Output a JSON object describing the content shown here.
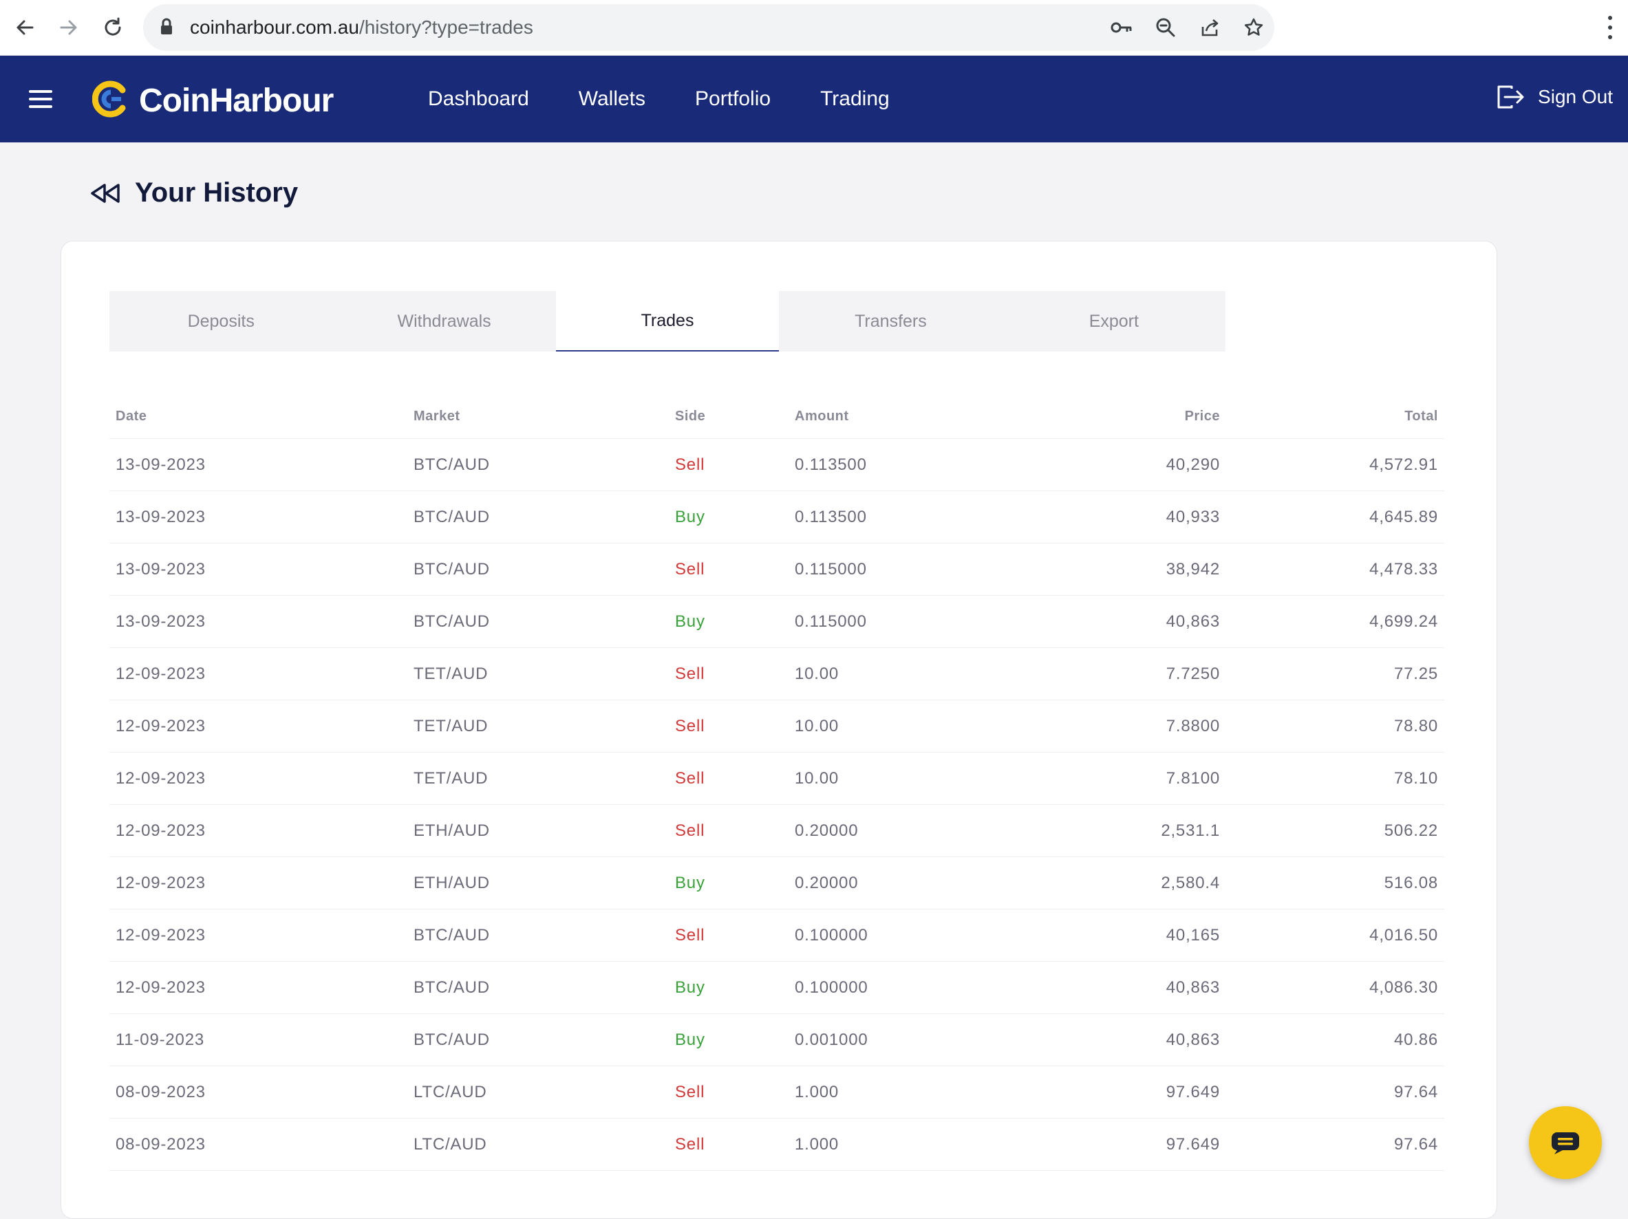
{
  "browser": {
    "url_host": "coinharbour.com.au",
    "url_path": "/history?type=trades"
  },
  "app": {
    "brand": "CoinHarbour",
    "nav": [
      "Dashboard",
      "Wallets",
      "Portfolio",
      "Trading"
    ],
    "sign_out": "Sign Out"
  },
  "page": {
    "title": "Your History"
  },
  "tabs": [
    {
      "label": "Deposits",
      "active": false
    },
    {
      "label": "Withdrawals",
      "active": false
    },
    {
      "label": "Trades",
      "active": true
    },
    {
      "label": "Transfers",
      "active": false
    },
    {
      "label": "Export",
      "active": false
    }
  ],
  "table": {
    "headers": {
      "date": "Date",
      "market": "Market",
      "side": "Side",
      "amount": "Amount",
      "price": "Price",
      "total": "Total"
    },
    "rows": [
      {
        "date": "13-09-2023",
        "market": "BTC/AUD",
        "side": "Sell",
        "amount": "0.113500",
        "price": "40,290",
        "total": "4,572.91"
      },
      {
        "date": "13-09-2023",
        "market": "BTC/AUD",
        "side": "Buy",
        "amount": "0.113500",
        "price": "40,933",
        "total": "4,645.89"
      },
      {
        "date": "13-09-2023",
        "market": "BTC/AUD",
        "side": "Sell",
        "amount": "0.115000",
        "price": "38,942",
        "total": "4,478.33"
      },
      {
        "date": "13-09-2023",
        "market": "BTC/AUD",
        "side": "Buy",
        "amount": "0.115000",
        "price": "40,863",
        "total": "4,699.24"
      },
      {
        "date": "12-09-2023",
        "market": "TET/AUD",
        "side": "Sell",
        "amount": "10.00",
        "price": "7.7250",
        "total": "77.25"
      },
      {
        "date": "12-09-2023",
        "market": "TET/AUD",
        "side": "Sell",
        "amount": "10.00",
        "price": "7.8800",
        "total": "78.80"
      },
      {
        "date": "12-09-2023",
        "market": "TET/AUD",
        "side": "Sell",
        "amount": "10.00",
        "price": "7.8100",
        "total": "78.10"
      },
      {
        "date": "12-09-2023",
        "market": "ETH/AUD",
        "side": "Sell",
        "amount": "0.20000",
        "price": "2,531.1",
        "total": "506.22"
      },
      {
        "date": "12-09-2023",
        "market": "ETH/AUD",
        "side": "Buy",
        "amount": "0.20000",
        "price": "2,580.4",
        "total": "516.08"
      },
      {
        "date": "12-09-2023",
        "market": "BTC/AUD",
        "side": "Sell",
        "amount": "0.100000",
        "price": "40,165",
        "total": "4,016.50"
      },
      {
        "date": "12-09-2023",
        "market": "BTC/AUD",
        "side": "Buy",
        "amount": "0.100000",
        "price": "40,863",
        "total": "4,086.30"
      },
      {
        "date": "11-09-2023",
        "market": "BTC/AUD",
        "side": "Buy",
        "amount": "0.001000",
        "price": "40,863",
        "total": "40.86"
      },
      {
        "date": "08-09-2023",
        "market": "LTC/AUD",
        "side": "Sell",
        "amount": "1.000",
        "price": "97.649",
        "total": "97.64"
      },
      {
        "date": "08-09-2023",
        "market": "LTC/AUD",
        "side": "Sell",
        "amount": "1.000",
        "price": "97.649",
        "total": "97.64"
      }
    ]
  },
  "colors": {
    "navbar": "#182a78",
    "sell": "#d23a3a",
    "buy": "#3aa13a",
    "chat": "#f5c518"
  },
  "icons": [
    "back-arrow-icon",
    "forward-arrow-icon",
    "reload-icon",
    "lock-icon",
    "key-icon",
    "zoom-icon",
    "share-icon",
    "star-icon",
    "menu-dots-icon",
    "hamburger-icon",
    "logo-icon",
    "sign-out-icon",
    "rewind-icon",
    "chat-icon"
  ]
}
